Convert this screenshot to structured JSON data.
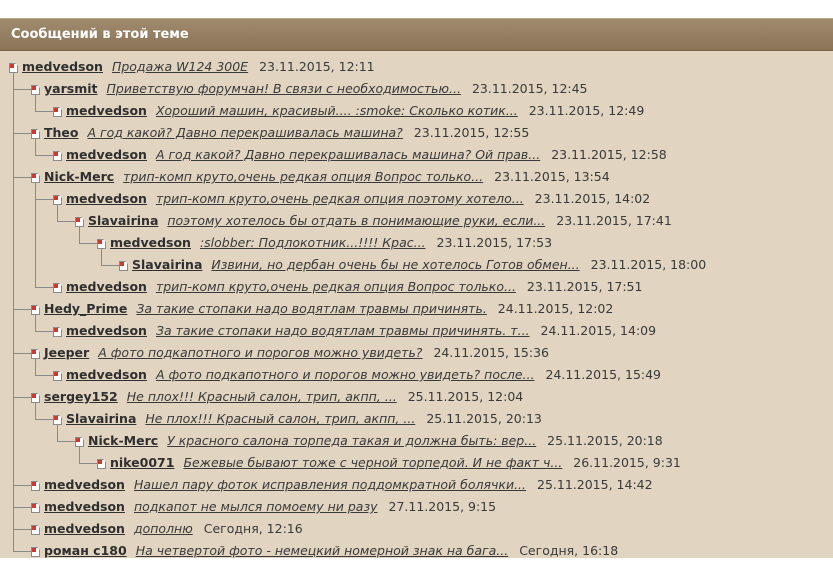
{
  "header": {
    "title": "Сообщений в этой теме"
  },
  "posts": [
    {
      "depth": 0,
      "author": "medvedson",
      "subject": "Продажа W124 300E",
      "date": "23.11.2015, 12:11"
    },
    {
      "depth": 1,
      "author": "yarsmit",
      "subject": "Приветствую форумчан! В связи с необходимостью...",
      "date": "23.11.2015, 12:45"
    },
    {
      "depth": 2,
      "author": "medvedson",
      "subject": "Хороший машин, красивый.... :smoke: Сколько котик...",
      "date": "23.11.2015, 12:49"
    },
    {
      "depth": 1,
      "author": "Theo",
      "subject": "А год какой? Давно перекрашивалась машина?",
      "date": "23.11.2015, 12:55"
    },
    {
      "depth": 2,
      "author": "medvedson",
      "subject": "А год какой? Давно перекрашивалась машина? Ой прав...",
      "date": "23.11.2015, 12:58"
    },
    {
      "depth": 1,
      "author": "Nick-Merc",
      "subject": "трип-комп круто,очень редкая опция Вопрос только...",
      "date": "23.11.2015, 13:54"
    },
    {
      "depth": 2,
      "author": "medvedson",
      "subject": "трип-комп круто,очень редкая опция поэтому хотело...",
      "date": "23.11.2015, 14:02"
    },
    {
      "depth": 3,
      "author": "Slavairina",
      "subject": "поэтому хотелось бы отдать в понимающие руки, если...",
      "date": "23.11.2015, 17:41"
    },
    {
      "depth": 4,
      "author": "medvedson",
      "subject": ":slobber: Подлокотник...!!!! Крас...",
      "date": "23.11.2015, 17:53"
    },
    {
      "depth": 5,
      "author": "Slavairina",
      "subject": "Извини, но дербан очень бы не хотелось Готов обмен...",
      "date": "23.11.2015, 18:00"
    },
    {
      "depth": 2,
      "author": "medvedson",
      "subject": "трип-комп круто,очень редкая опция Вопрос только...",
      "date": "23.11.2015, 17:51"
    },
    {
      "depth": 1,
      "author": "Hedy_Prime",
      "subject": "За такие стопаки надо водятлам травмы причинять.",
      "date": "24.11.2015, 12:02"
    },
    {
      "depth": 2,
      "author": "medvedson",
      "subject": "За такие стопаки надо водятлам травмы причинять. т...",
      "date": "24.11.2015, 14:09"
    },
    {
      "depth": 1,
      "author": "Jeeper",
      "subject": "А фото подкапотного и порогов можно увидеть?",
      "date": "24.11.2015, 15:36"
    },
    {
      "depth": 2,
      "author": "medvedson",
      "subject": "А фото подкапотного и порогов можно увидеть? после...",
      "date": "24.11.2015, 15:49"
    },
    {
      "depth": 1,
      "author": "sergey152",
      "subject": "Не плох!!! Красный салон, трип, акпп, ...",
      "date": "25.11.2015, 12:04"
    },
    {
      "depth": 2,
      "author": "Slavairina",
      "subject": "Не плох!!! Красный салон, трип, акпп, ...",
      "date": "25.11.2015, 20:13"
    },
    {
      "depth": 3,
      "author": "Nick-Merc",
      "subject": "У красного салона торпеда такая и должна быть: вер...",
      "date": "25.11.2015, 20:18"
    },
    {
      "depth": 4,
      "author": "nike0071",
      "subject": "Бежевые бывают тоже с черной торпедой. И не факт ч...",
      "date": "26.11.2015, 9:31"
    },
    {
      "depth": 1,
      "author": "medvedson",
      "subject": "Нашел пару фоток исправления поддомкратной болячки...",
      "date": "25.11.2015, 14:42"
    },
    {
      "depth": 1,
      "author": "medvedson",
      "subject": "подкапот не мылся помоему ни разу",
      "date": "27.11.2015, 9:15"
    },
    {
      "depth": 1,
      "author": "medvedson",
      "subject": "дополню",
      "date": "Сегодня, 12:16"
    },
    {
      "depth": 1,
      "author": "роман с180",
      "subject": "На четвертой фото - немецкий номерной знак на бага...",
      "date": "Сегодня, 16:18"
    }
  ]
}
